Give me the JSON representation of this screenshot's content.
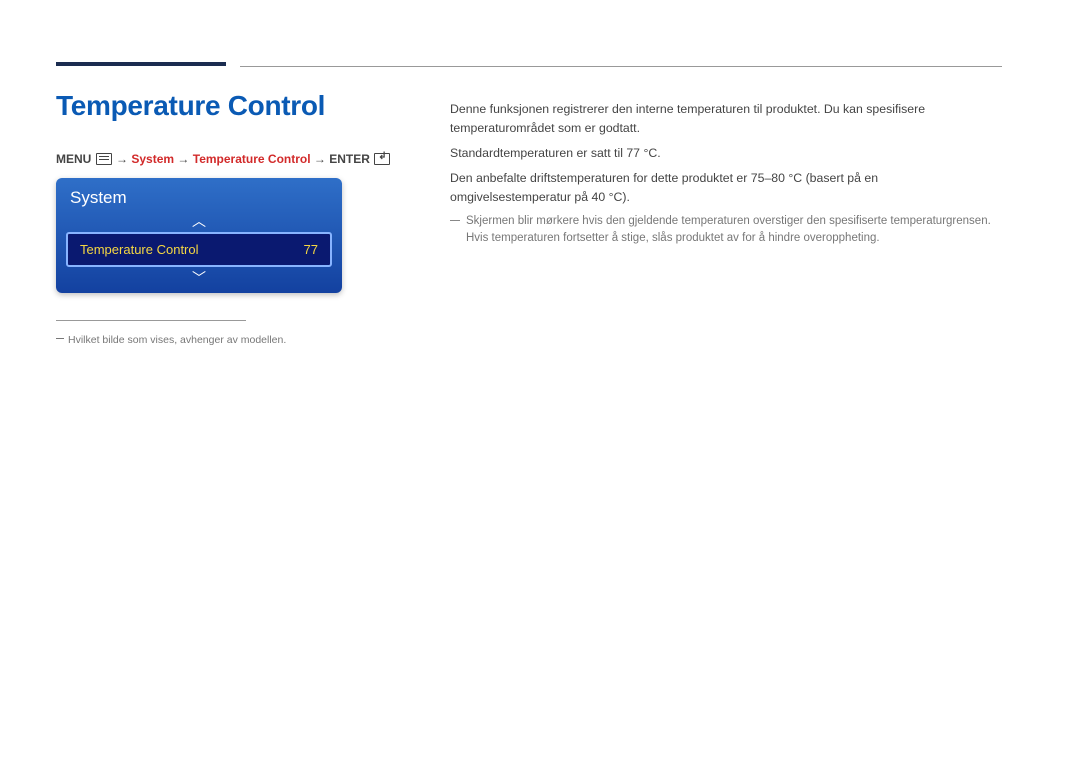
{
  "page": {
    "title": "Temperature Control"
  },
  "breadcrumb": {
    "menu": "MENU",
    "arrow": "→",
    "system": "System",
    "temp": "Temperature Control",
    "enter": "ENTER"
  },
  "osd": {
    "header": "System",
    "row_label": "Temperature Control",
    "row_value": "77"
  },
  "footnote": "Hvilket bilde som vises, avhenger av modellen.",
  "body": {
    "p1": "Denne funksjonen registrerer den interne temperaturen til produktet. Du kan spesifisere temperaturområdet som er godtatt.",
    "p2": "Standardtemperaturen er satt til 77 °C.",
    "p3": "Den anbefalte driftstemperaturen for dette produktet er 75–80 °C (basert på en omgivelsestemperatur på 40 °C).",
    "note": "Skjermen blir mørkere hvis den gjeldende temperaturen overstiger den spesifiserte temperaturgrensen. Hvis temperaturen fortsetter å stige, slås produktet av for å hindre overoppheting."
  }
}
